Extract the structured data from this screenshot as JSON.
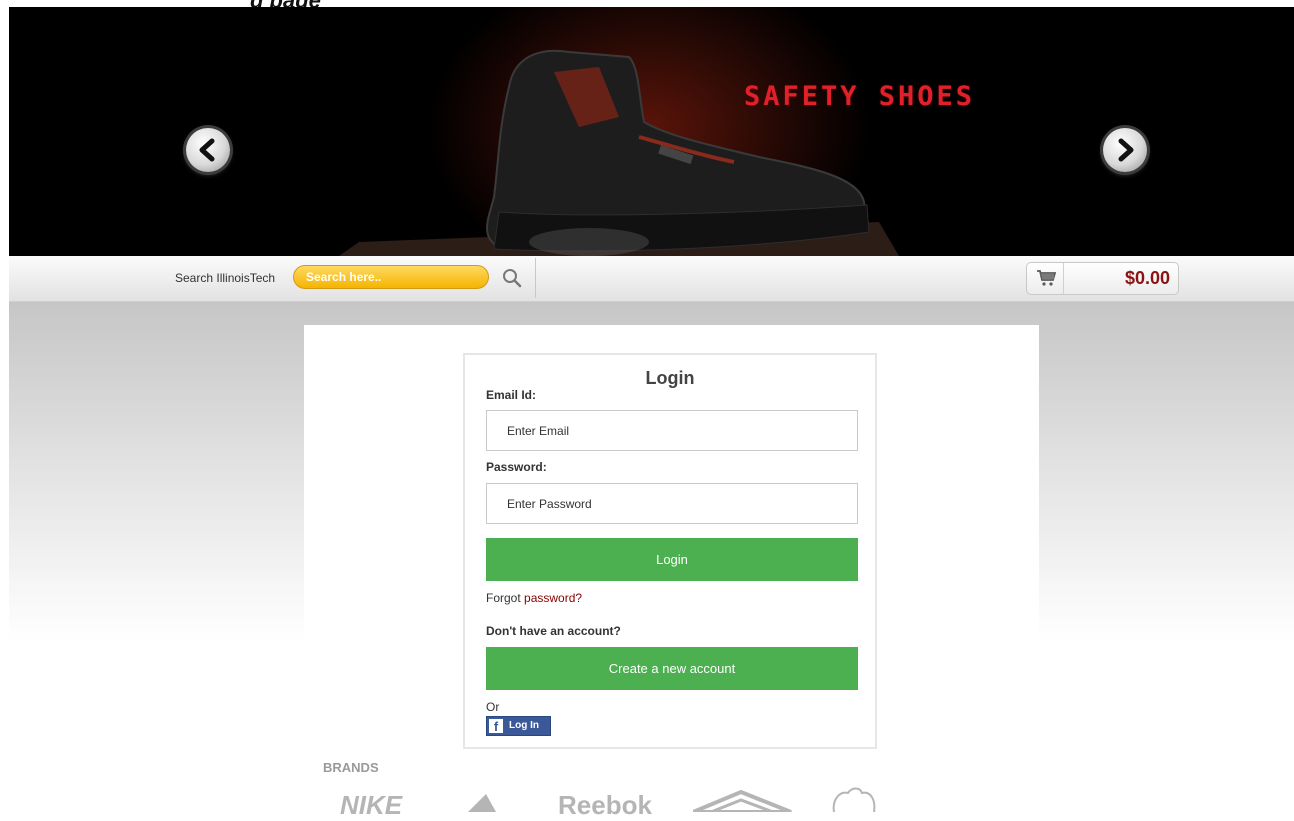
{
  "page": {
    "header_cut_text": "g page"
  },
  "banner": {
    "title": "SAFETY SHOES",
    "prev_icon": "chevron-left-icon",
    "next_icon": "chevron-right-icon"
  },
  "search": {
    "label": "Search IllinoisTech",
    "placeholder": "Search here..",
    "button_icon": "search-icon"
  },
  "cart": {
    "icon": "cart-icon",
    "total": "$0.00"
  },
  "login": {
    "title": "Login",
    "email_label": "Email Id:",
    "email_placeholder": "Enter Email",
    "password_label": "Password:",
    "password_placeholder": "Enter Password",
    "login_button": "Login",
    "forgot_prefix": "Forgot ",
    "forgot_link": "password?",
    "no_account": "Don't have an account?",
    "create_button": "Create a new account",
    "or_text": "Or",
    "fb_login": "Log In"
  },
  "brands": {
    "title": "BRANDS",
    "items": [
      "NIKE",
      "adidas",
      "Reebok",
      "Umbro",
      "Puma"
    ]
  },
  "colors": {
    "accent_green": "#4caf50",
    "search_yellow": "#f5b400",
    "price_red": "#8c1313",
    "banner_title_red": "#e0212a",
    "facebook_blue": "#3b5998"
  }
}
